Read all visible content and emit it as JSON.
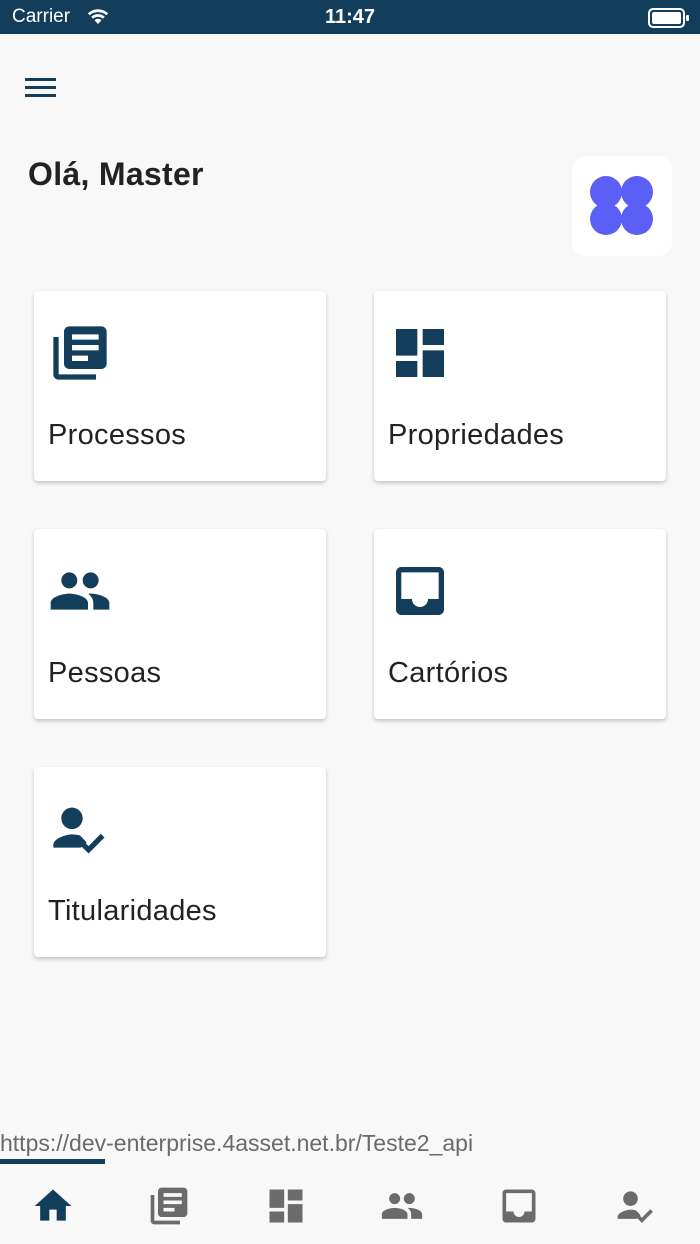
{
  "status_bar": {
    "carrier": "Carrier",
    "time": "11:47"
  },
  "greeting": "Olá, Master",
  "colors": {
    "primary": "#123e5c",
    "logo": "#5b5ff5",
    "inactive": "#6b6b6b"
  },
  "cards": [
    {
      "label": "Processos",
      "icon": "document-list-icon"
    },
    {
      "label": "Propriedades",
      "icon": "dashboard-icon"
    },
    {
      "label": "Pessoas",
      "icon": "people-icon"
    },
    {
      "label": "Cartórios",
      "icon": "inbox-icon"
    },
    {
      "label": "Titularidades",
      "icon": "person-check-icon"
    }
  ],
  "footer_url": "https://dev-enterprise.4asset.net.br/Teste2_api",
  "url_load_progress": 0.15,
  "bottom_nav": [
    {
      "icon": "home-icon",
      "active": true
    },
    {
      "icon": "document-list-icon",
      "active": false
    },
    {
      "icon": "dashboard-icon",
      "active": false
    },
    {
      "icon": "people-icon",
      "active": false
    },
    {
      "icon": "inbox-icon",
      "active": false
    },
    {
      "icon": "person-check-icon",
      "active": false
    }
  ]
}
